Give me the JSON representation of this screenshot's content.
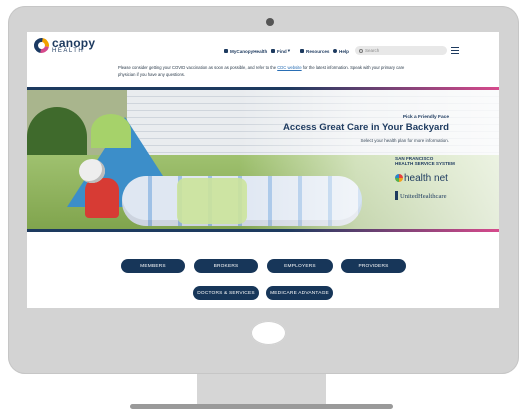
{
  "header": {
    "logo_word": "canopy",
    "logo_sub": "HEALTH",
    "nav": [
      {
        "label": "MyCanopyHealth",
        "icon": "lock-icon"
      },
      {
        "label": "Find",
        "icon": "person-icon"
      },
      {
        "label": "Resources",
        "icon": "house-icon"
      },
      {
        "label": "Help",
        "icon": "help-icon"
      }
    ],
    "search_placeholder": "Search"
  },
  "notice": {
    "text_before": "Please consider getting your COVID vaccination as soon as possible, and refer to the ",
    "link": "CDC website",
    "text_after": " for the latest information. Speak with your primary care physician if you have any questions."
  },
  "hero": {
    "kicker": "Pick a Friendly Face",
    "headline": "Access Great Care in Your Backyard",
    "subline": "Select your health plan for more information.",
    "partners": {
      "sfhss_line1": "SAN FRANCISCO",
      "sfhss_line2": "HEALTH SERVICE SYSTEM",
      "healthnet": "health net",
      "uhc": "UnitedHealthcare"
    }
  },
  "buttons": {
    "row1": [
      "MEMBERS",
      "BROKERS",
      "EMPLOYERS",
      "PROVIDERS"
    ],
    "row2": [
      "DOCTORS & SERVICES",
      "MEDICARE ADVANTAGE"
    ]
  },
  "colors": {
    "brand_navy": "#173659",
    "accent_pink": "#d64a8c",
    "accent_orange": "#f1a000"
  }
}
